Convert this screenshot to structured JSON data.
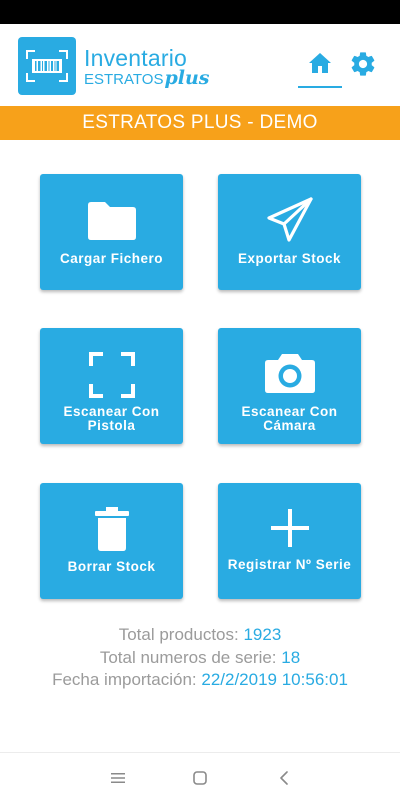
{
  "app": {
    "logo_title": "Inventario",
    "logo_sub": "ESTRATOS",
    "logo_plus": "plus",
    "accent": "#29abe2",
    "banner_color": "#f7a11a"
  },
  "header": {
    "home_icon": "home-icon",
    "settings_icon": "gear-icon"
  },
  "banner": {
    "text": "ESTRATOS PLUS - DEMO"
  },
  "tiles": [
    {
      "label": "Cargar Fichero",
      "icon": "folder-icon"
    },
    {
      "label": "Exportar Stock",
      "icon": "paper-plane-icon"
    },
    {
      "label": "Escanear Con Pistola",
      "icon": "scan-frame-icon"
    },
    {
      "label": "Escanear Con Cámara",
      "icon": "camera-icon"
    },
    {
      "label": "Borrar Stock",
      "icon": "trash-icon"
    },
    {
      "label": "Registrar Nº Serie",
      "icon": "plus-icon"
    }
  ],
  "info": {
    "products_label": "Total productos: ",
    "products_value": "1923",
    "serials_label": "Total numeros de serie: ",
    "serials_value": "18",
    "import_label": "Fecha importación: ",
    "import_value": "22/2/2019 10:56:01"
  },
  "navbar": {
    "menu_icon": "menu-icon",
    "home_icon": "home-square-icon",
    "back_icon": "back-icon"
  }
}
